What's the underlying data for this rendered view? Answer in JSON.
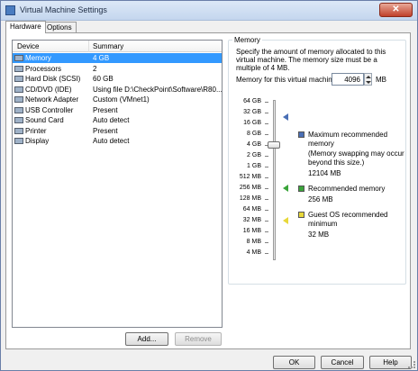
{
  "window": {
    "title": "Virtual Machine Settings",
    "close_glyph": "✕"
  },
  "tabs": [
    {
      "label": "Hardware",
      "selected": true
    },
    {
      "label": "Options",
      "selected": false
    }
  ],
  "device_list": {
    "headers": {
      "device": "Device",
      "summary": "Summary"
    },
    "rows": [
      {
        "icon": "memory-icon",
        "device": "Memory",
        "summary": "4 GB",
        "selected": true
      },
      {
        "icon": "processor-icon",
        "device": "Processors",
        "summary": "2",
        "selected": false
      },
      {
        "icon": "hard-disk-icon",
        "device": "Hard Disk (SCSI)",
        "summary": "60 GB",
        "selected": false
      },
      {
        "icon": "cd-dvd-icon",
        "device": "CD/DVD (IDE)",
        "summary": "Using file D:\\CheckPoint\\Software\\R80...",
        "selected": false
      },
      {
        "icon": "network-adapter-icon",
        "device": "Network Adapter",
        "summary": "Custom (VMnet1)",
        "selected": false
      },
      {
        "icon": "usb-controller-icon",
        "device": "USB Controller",
        "summary": "Present",
        "selected": false
      },
      {
        "icon": "sound-card-icon",
        "device": "Sound Card",
        "summary": "Auto detect",
        "selected": false
      },
      {
        "icon": "printer-icon",
        "device": "Printer",
        "summary": "Present",
        "selected": false
      },
      {
        "icon": "display-icon",
        "device": "Display",
        "summary": "Auto detect",
        "selected": false
      }
    ],
    "add_label": "Add...",
    "remove_label": "Remove"
  },
  "memory": {
    "group_title": "Memory",
    "description": "Specify the amount of memory allocated to this virtual machine. The memory size must be a multiple of 4 MB.",
    "field_label": "Memory for this virtual machine:",
    "value": "4096",
    "unit": "MB",
    "scale_ticks": [
      "64 GB",
      "32 GB",
      "16 GB",
      "8 GB",
      "4 GB",
      "2 GB",
      "1 GB",
      "512 MB",
      "256 MB",
      "128 MB",
      "64 MB",
      "32 MB",
      "16 MB",
      "8 MB",
      "4 MB"
    ],
    "slider_level": "4 GB",
    "legend": [
      {
        "kind": "max",
        "title": "Maximum recommended memory",
        "note": "(Memory swapping may occur beyond this size.)",
        "value": "12104 MB",
        "color": "#4a6fb5"
      },
      {
        "kind": "recommended",
        "title": "Recommended memory",
        "note": "",
        "value": "256 MB",
        "color": "#3aa43a"
      },
      {
        "kind": "guest-min",
        "title": "Guest OS recommended minimum",
        "note": "",
        "value": "32 MB",
        "color": "#e8d83a"
      }
    ]
  },
  "footer": {
    "ok_label": "OK",
    "cancel_label": "Cancel",
    "help_label": "Help"
  }
}
